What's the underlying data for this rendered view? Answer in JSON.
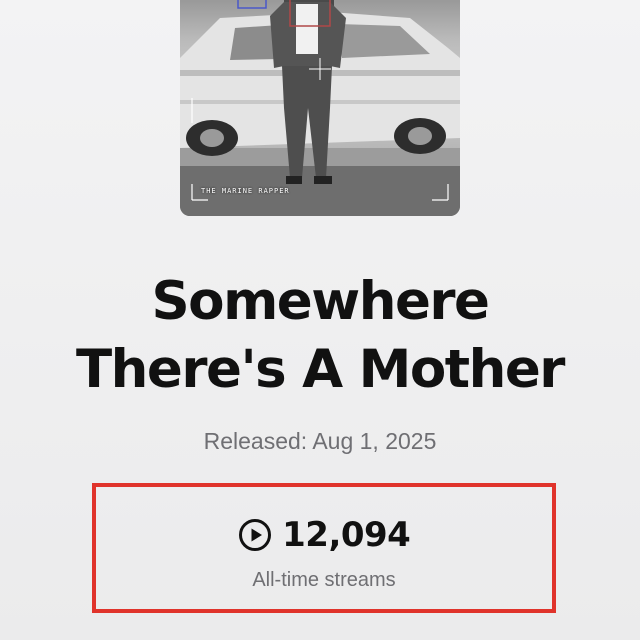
{
  "artwork": {
    "caption": "THE MARINE RAPPER",
    "icon": "album-cover-image"
  },
  "track": {
    "title_line1": "Somewhere",
    "title_line2": "There's A Mother",
    "released": "Released: Aug 1, 2025"
  },
  "stats": {
    "icon": "play-circle-icon",
    "streams": "12,094",
    "streams_label": "All-time streams"
  },
  "colors": {
    "highlight_frame": "#e0332b",
    "text_primary": "#111111",
    "text_secondary": "#6f6f73"
  }
}
